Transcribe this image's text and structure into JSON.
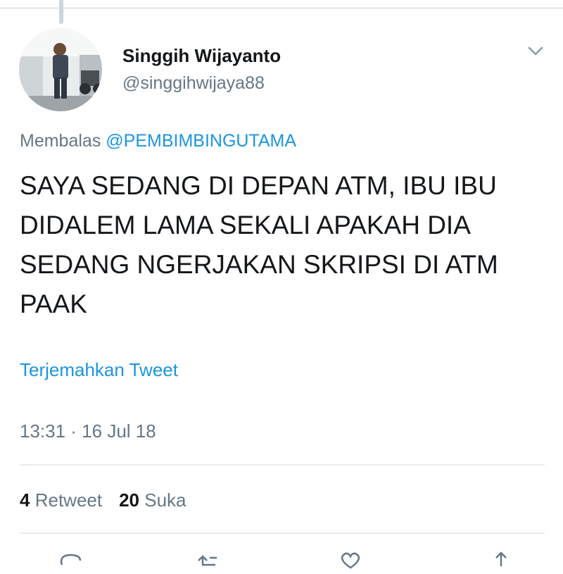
{
  "tweet": {
    "author": {
      "display_name": "Singgih Wijayanto",
      "handle": "@singgihwijaya88"
    },
    "reply": {
      "prefix": "Membalas",
      "to": "@PEMBIMBINGUTAMA"
    },
    "text": "SAYA SEDANG DI DEPAN ATM, IBU IBU DIDALEM LAMA SEKALI APAKAH DIA SEDANG NGERJAKAN SKRIPSI DI ATM PAAK",
    "translate_label": "Terjemahkan Tweet",
    "timestamp": "13:31 · 16 Jul 18",
    "stats": {
      "retweets": "4",
      "retweet_label": "Retweet",
      "likes": "20",
      "likes_label": "Suka"
    }
  },
  "icons": {
    "more_menu": "chevron-down-icon",
    "actions": [
      "reply-icon",
      "retweet-icon",
      "like-icon",
      "share-icon"
    ]
  },
  "colors": {
    "link": "#1b95e0",
    "text_primary": "#14171a",
    "text_secondary": "#657786",
    "divider": "#e6ecf0"
  }
}
